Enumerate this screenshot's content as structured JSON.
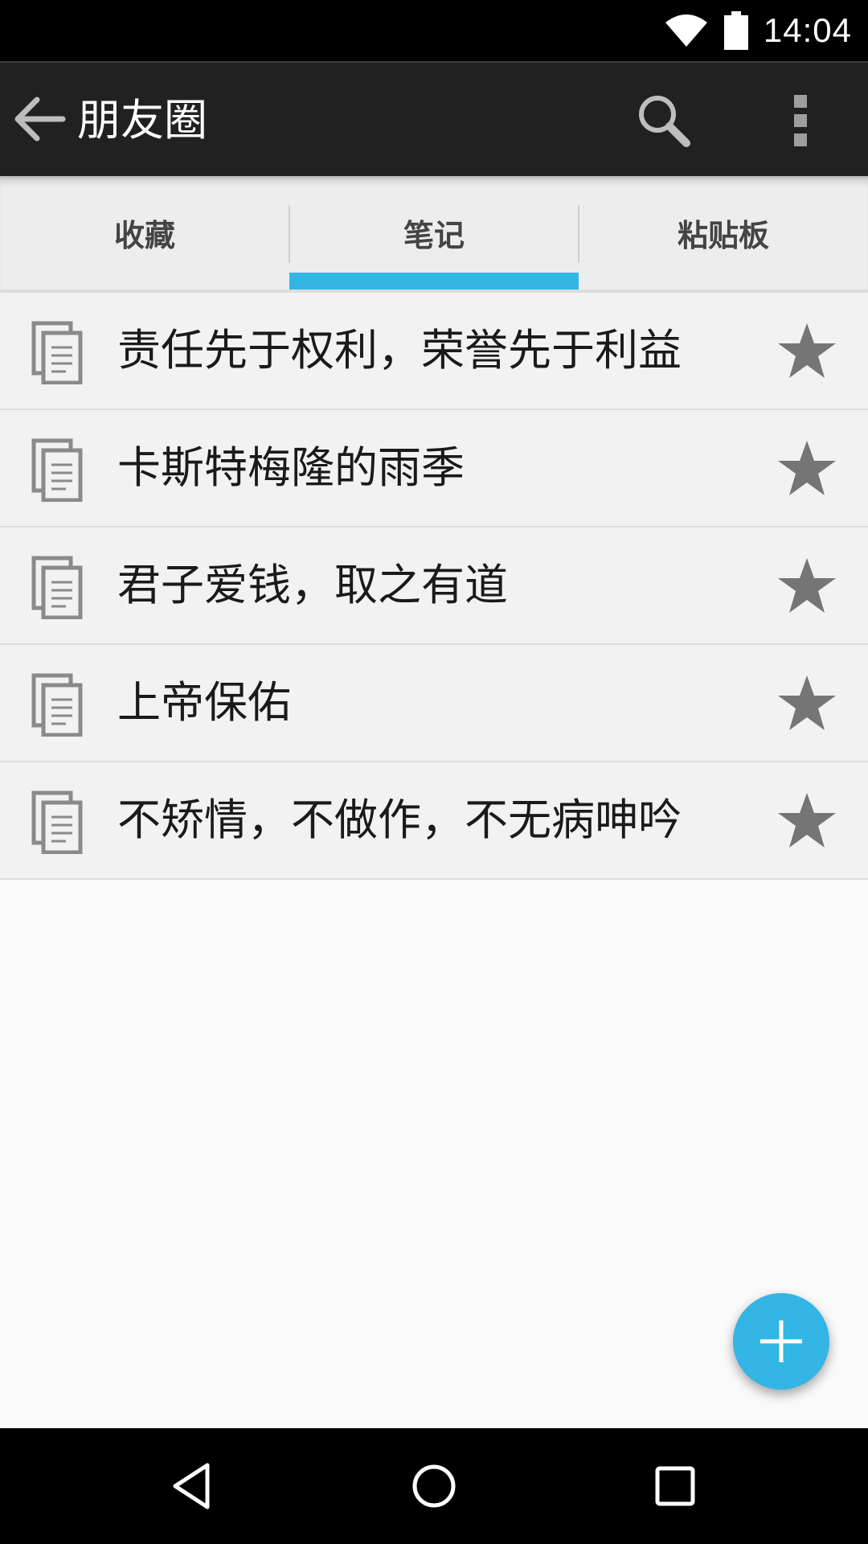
{
  "status_bar": {
    "time": "14:04",
    "icons": [
      "wifi-icon",
      "battery-icon"
    ]
  },
  "app_bar": {
    "title": "朋友圈",
    "icons": [
      "back-arrow-icon",
      "search-icon",
      "overflow-menu-icon"
    ]
  },
  "tabs": [
    {
      "label": "收藏",
      "selected": false
    },
    {
      "label": "笔记",
      "selected": true
    },
    {
      "label": "粘贴板",
      "selected": false
    }
  ],
  "notes": [
    {
      "text": "责任先于权利，荣誉先于利益",
      "starred": true
    },
    {
      "text": "卡斯特梅隆的雨季",
      "starred": true
    },
    {
      "text": "君子爱钱，取之有道",
      "starred": true
    },
    {
      "text": "上帝保佑",
      "starred": true
    },
    {
      "text": "不矫情，不做作，不无病呻吟",
      "starred": true
    }
  ],
  "fab": {
    "icon": "plus-icon"
  },
  "nav_bar": {
    "icons": [
      "nav-back-icon",
      "nav-home-icon",
      "nav-recents-icon"
    ]
  },
  "colors": {
    "accent": "#33b5e5",
    "app_bar": "#212121",
    "star": "#757575"
  }
}
